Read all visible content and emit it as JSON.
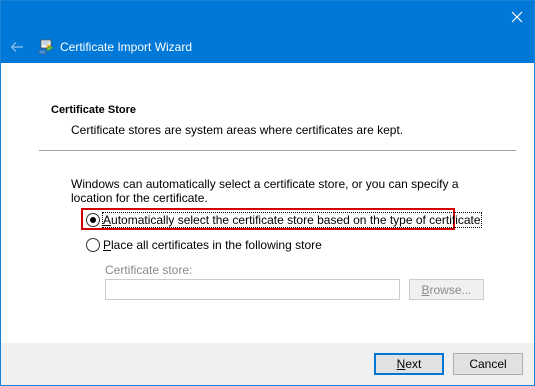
{
  "window": {
    "title": "Certificate Import Wizard",
    "close_glyph": "✕"
  },
  "header": {
    "back_icon": "back-arrow-icon",
    "wizard_icon": "certificate-wizard-icon"
  },
  "section": {
    "title": "Certificate Store",
    "description": "Certificate stores are system areas where certificates are kept."
  },
  "info_text": "Windows can automatically select a certificate store, or you can specify a location for the certificate.",
  "options": [
    {
      "label_first": "A",
      "label_rest": "utomatically select the certificate store based on the type of certificate",
      "selected": true
    },
    {
      "label_first": "P",
      "label_rest": "lace all certificates in the following store",
      "selected": false
    }
  ],
  "store": {
    "label": "Certificate store:",
    "value": "",
    "browse_first": "B",
    "browse_rest": "rowse..."
  },
  "buttons": {
    "next_first": "N",
    "next_rest": "ext",
    "cancel": "Cancel"
  },
  "colors": {
    "titlebar": "#0078d7",
    "highlight": "#d40000",
    "footer": "#f0f0f0"
  }
}
